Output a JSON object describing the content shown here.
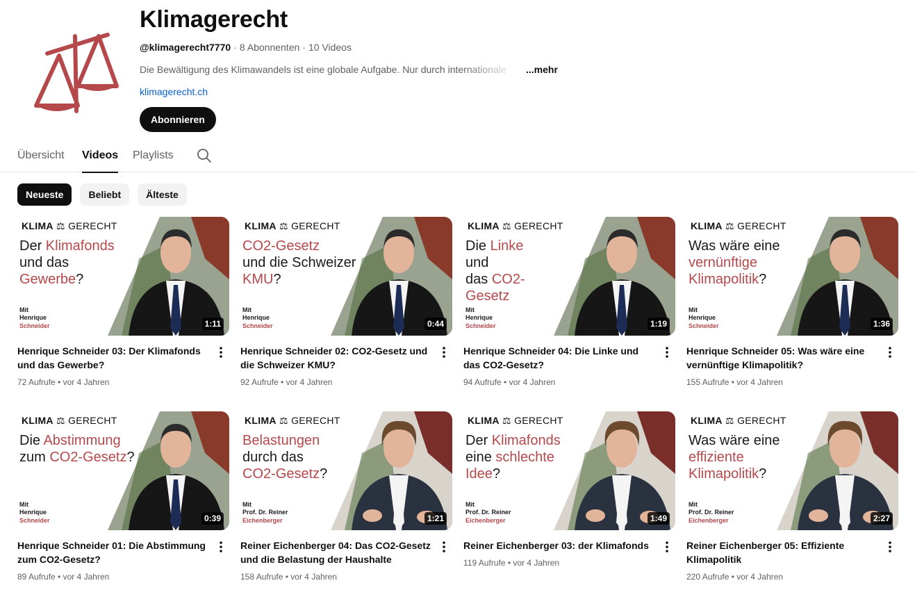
{
  "channel": {
    "name": "Klimagerecht",
    "handle": "@klimagerecht7770",
    "subscribers": "8 Abonnenten",
    "video_count": "10 Videos",
    "description": "Die Bewältigung des Klimawandels ist eine globale Aufgabe. Nur durch internationale",
    "more_label": "...mehr",
    "link": "klimagerecht.ch",
    "subscribe_label": "Abonnieren",
    "logo_color": "#b5484a"
  },
  "tabs": [
    {
      "label": "Übersicht",
      "active": false
    },
    {
      "label": "Videos",
      "active": true
    },
    {
      "label": "Playlists",
      "active": false
    }
  ],
  "search_icon": "search-icon",
  "chips": [
    {
      "label": "Neueste",
      "active": true
    },
    {
      "label": "Beliebt",
      "active": false
    },
    {
      "label": "Älteste",
      "active": false
    }
  ],
  "thumb_brand": {
    "left": "KLIMA",
    "right": "GERECHT"
  },
  "videos": [
    {
      "title": "Henrique Schneider 03: Der Klimafonds und das Gewerbe?",
      "views": "72 Aufrufe",
      "age": "vor 4 Jahren",
      "duration": "1:11",
      "thumb_lines": [
        [
          "Der ",
          "Klimafonds"
        ],
        [
          "und das",
          ""
        ],
        [
          "",
          "Gewerbe"
        ],
        [
          "?",
          ""
        ]
      ],
      "mit": [
        "Mit",
        "Henrique",
        "Schneider"
      ],
      "person": "a"
    },
    {
      "title": "Henrique Schneider 02: CO2-Gesetz und die Schweizer KMU?",
      "views": "92 Aufrufe",
      "age": "vor 4 Jahren",
      "duration": "0:44",
      "thumb_lines": [
        [
          "",
          "CO2-Gesetz"
        ],
        [
          "und die Schweizer",
          ""
        ],
        [
          "",
          "KMU"
        ],
        [
          "?",
          ""
        ]
      ],
      "mit": [
        "Mit",
        "Henrique",
        "Schneider"
      ],
      "person": "a"
    },
    {
      "title": "Henrique Schneider 04: Die Linke und das CO2-Gesetz?",
      "views": "94 Aufrufe",
      "age": "vor 4 Jahren",
      "duration": "1:19",
      "thumb_lines": [
        [
          "Die ",
          "Linke"
        ],
        [
          " und",
          ""
        ],
        [
          "das ",
          "CO2-"
        ],
        [
          "",
          "Gesetz"
        ]
      ],
      "mit": [
        "Mit",
        "Henrique",
        "Schneider"
      ],
      "person": "a"
    },
    {
      "title": "Henrique Schneider 05: Was wäre eine vernünftige Klimapolitik?",
      "views": "155 Aufrufe",
      "age": "vor 4 Jahren",
      "duration": "1:36",
      "thumb_lines": [
        [
          "Was wäre eine",
          ""
        ],
        [
          "",
          "vernünftige"
        ],
        [
          "",
          "Klimapolitik"
        ],
        [
          "?",
          ""
        ]
      ],
      "mit": [
        "Mit",
        "Henrique",
        "Schneider"
      ],
      "person": "a"
    },
    {
      "title": "Henrique Schneider 01: Die Abstimmung zum CO2-Gesetz?",
      "views": "89 Aufrufe",
      "age": "vor 4 Jahren",
      "duration": "0:39",
      "thumb_lines": [
        [
          "Die ",
          "Abstimmung"
        ],
        [
          "zum ",
          "CO2-Gesetz"
        ],
        [
          "?",
          ""
        ],
        [
          "",
          ""
        ]
      ],
      "mit": [
        "Mit",
        "Henrique",
        "Schneider"
      ],
      "person": "a"
    },
    {
      "title": "Reiner Eichenberger 04: Das CO2-Gesetz und die Belastung der Haushalte",
      "views": "158 Aufrufe",
      "age": "vor 4 Jahren",
      "duration": "1:21",
      "thumb_lines": [
        [
          "",
          "Belastungen"
        ],
        [
          "durch das",
          ""
        ],
        [
          "",
          "CO2-Gesetz"
        ],
        [
          "?",
          ""
        ]
      ],
      "mit": [
        "Mit",
        "Prof. Dr. Reiner",
        "Eichenberger"
      ],
      "person": "b"
    },
    {
      "title": "Reiner Eichenberger 03: der Klimafonds",
      "views": "119 Aufrufe",
      "age": "vor 4 Jahren",
      "duration": "1:49",
      "thumb_lines": [
        [
          "Der ",
          "Klimafonds"
        ],
        [
          "eine ",
          "schlechte"
        ],
        [
          "",
          "Idee"
        ],
        [
          "?",
          ""
        ]
      ],
      "mit": [
        "Mit",
        "Prof. Dr. Reiner",
        "Eichenberger"
      ],
      "person": "b"
    },
    {
      "title": "Reiner Eichenberger 05: Effiziente Klimapolitik",
      "views": "220 Aufrufe",
      "age": "vor 4 Jahren",
      "duration": "2:27",
      "thumb_lines": [
        [
          "Was wäre eine",
          ""
        ],
        [
          "",
          "effiziente"
        ],
        [
          "",
          "Klimapolitik"
        ],
        [
          "?",
          ""
        ]
      ],
      "mit": [
        "Mit",
        "Prof. Dr. Reiner",
        "Eichenberger"
      ],
      "person": "b"
    }
  ]
}
